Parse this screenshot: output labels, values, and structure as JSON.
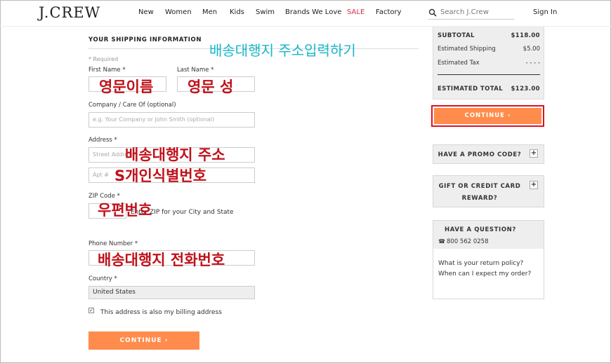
{
  "header": {
    "logo": "J.CREW",
    "nav": [
      "New",
      "Women",
      "Men",
      "Kids",
      "Swim",
      "Brands We Love",
      "SALE",
      "Factory"
    ],
    "search_placeholder": "Search J.Crew",
    "sign_in": "Sign In",
    "sale_color": "#d0324a"
  },
  "form": {
    "section_title": "YOUR SHIPPING INFORMATION",
    "required_note": "* Required",
    "first_name_label": "First Name *",
    "last_name_label": "Last Name *",
    "company_label": "Company / Care Of (optional)",
    "company_placeholder": "e.g. Your Company or John Smith (optional)",
    "address_label": "Address *",
    "address1_placeholder": "Street Address",
    "address2_placeholder": "Apt #",
    "zip_label": "ZIP Code *",
    "zip_note": "Enter ZIP for your City and State",
    "phone_label": "Phone Number *",
    "country_label": "Country *",
    "country_value": "United States",
    "billing_checkbox_label": "This address is also my billing address",
    "billing_checked": true,
    "continue_label": "CONTINUE ›"
  },
  "annotations": {
    "shipping_agent_address_input": "배송대행지 주소입력하기",
    "first_name_english": "영문이름",
    "last_name_english": "영문 성",
    "agent_address": "배송대행지 주소",
    "personal_id": "S개인식별번호",
    "zip_code": "우편번호",
    "agent_phone": "배송대행지 전화번호"
  },
  "summary": {
    "subtotal_label": "SUBTOTAL",
    "subtotal_value": "$118.00",
    "shipping_label": "Estimated Shipping",
    "shipping_value": "$5.00",
    "tax_label": "Estimated Tax",
    "tax_value": "- - - -",
    "total_label": "ESTIMATED TOTAL",
    "total_value": "$123.00",
    "continue_label": "CONTINUE ›"
  },
  "promo": {
    "label": "HAVE A PROMO CODE?",
    "toggle": "+"
  },
  "gift": {
    "label_line1": "GIFT OR CREDIT CARD",
    "label_line2": "REWARD?",
    "toggle": "+"
  },
  "help": {
    "title": "HAVE A QUESTION?",
    "phone": "800 562 0258",
    "link1": "What is your return policy?",
    "link2": "When can I expect my order?"
  },
  "colors": {
    "accent": "#ff8c4c",
    "highlight_border": "#e0111e",
    "annotation_red": "#c0111a",
    "annotation_teal": "#17b6c9"
  }
}
